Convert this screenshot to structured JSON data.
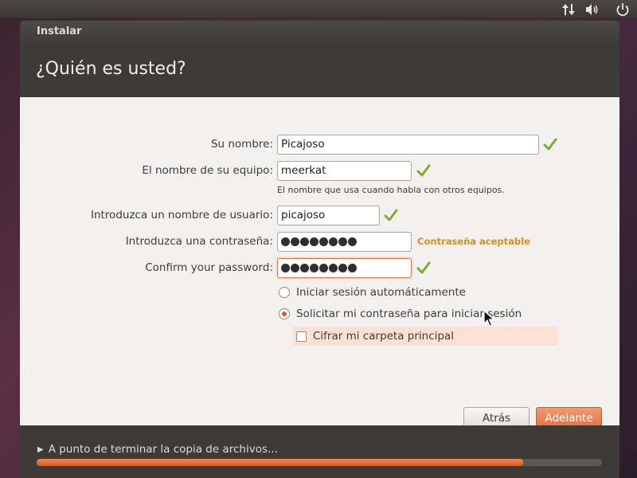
{
  "panel": {
    "icons": [
      "network-arrows-icon",
      "volume-icon",
      "power-icon"
    ]
  },
  "window": {
    "title": "Instalar",
    "heading": "¿Quién es usted?"
  },
  "form": {
    "name_label": "Su nombre:",
    "name_value": "Picajoso",
    "computer_label": "El nombre de su equipo:",
    "computer_value": "meerkat",
    "computer_hint": "El nombre que usa cuando habla con otros equipos.",
    "username_label": "Introduzca un nombre de usuario:",
    "username_value": "picajoso",
    "password_label": "Introduzca una contraseña:",
    "password_length": 8,
    "password_strength": "Contraseña aceptable",
    "confirm_label": "Confirm your password:",
    "confirm_length": 8,
    "auto_login_label": "Iniciar sesión automáticamente",
    "require_password_label": "Solicitar mi contraseña para iniciar sesión",
    "encrypt_home_label": "Cifrar mi carpeta principal"
  },
  "buttons": {
    "back_label": "Atrás",
    "next_label": "Adelante"
  },
  "footer": {
    "status_text": "A punto de terminar la copia de archivos...",
    "progress": 0.86
  },
  "colors": {
    "accent": "#e6703f",
    "strength": "#e28b12",
    "check": "#7cae2a"
  }
}
